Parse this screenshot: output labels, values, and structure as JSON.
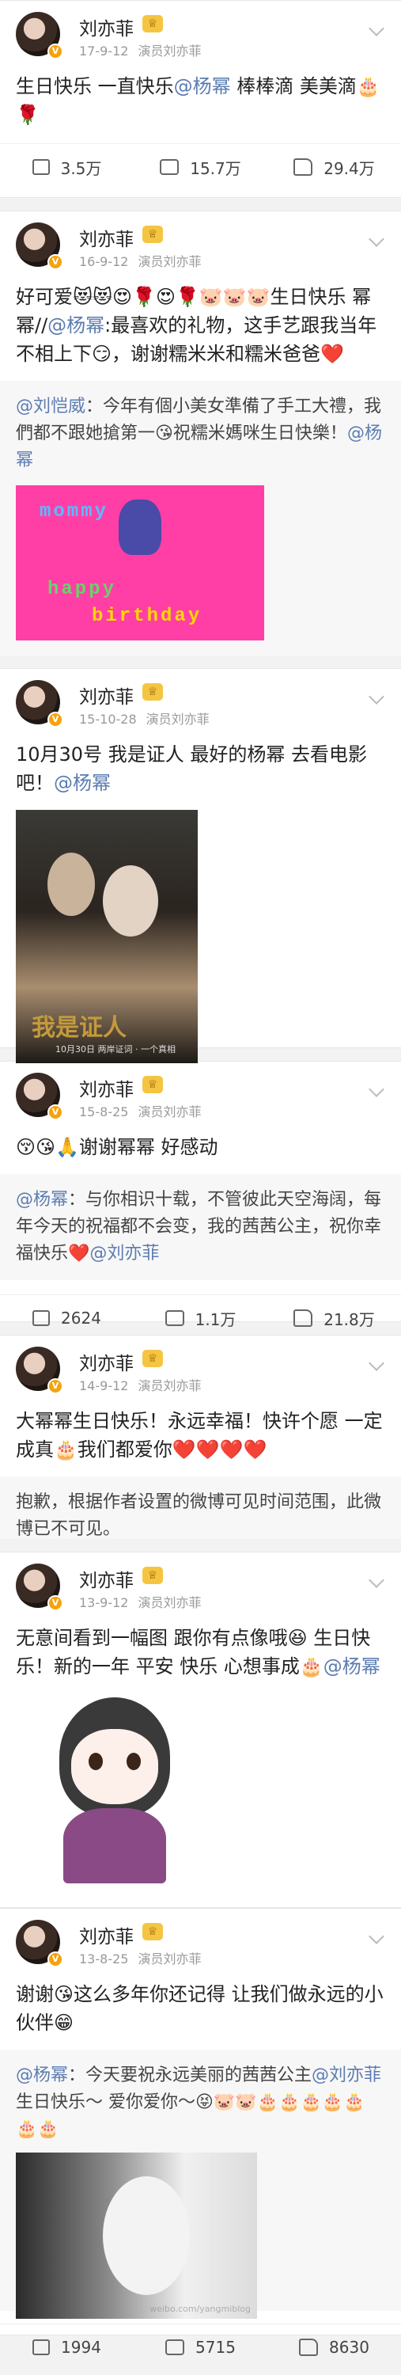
{
  "user": {
    "name": "刘亦菲",
    "verified": "V",
    "crown": "♕",
    "source": "演员刘亦菲"
  },
  "posts": [
    {
      "date": "17-9-12",
      "text_parts": [
        "生日快乐 一直快乐",
        "@杨幂",
        " 棒棒滴 美美滴🎂🌹"
      ],
      "stats": {
        "share": "3.5万",
        "comment": "15.7万",
        "like": "29.4万"
      }
    },
    {
      "date": "16-9-12",
      "text_parts": [
        "好可爱😻😻😍🌹😍🌹🐷🐷🐷生日快乐 幂幂//",
        "@杨幂",
        ":最喜欢的礼物，这手艺跟我当年不相上下😏，谢谢糯米米和糯米爸爸❤️"
      ],
      "repost_parts": [
        "@刘恺威",
        "：今年有個小美女準備了手工大禮，我們都不跟她搶第一😘祝糯米媽咪生日快樂！",
        "@杨幂"
      ],
      "image_words": [
        "mommy",
        "happy",
        "birthday"
      ]
    },
    {
      "date": "15-10-28",
      "text_parts": [
        "10月30号 我是证人 最好的杨幂 去看电影吧！",
        "@杨幂"
      ],
      "image_title": "我是证人",
      "image_sub": "10月30日 两岸证词 · 一个真相"
    },
    {
      "date": "15-8-25",
      "text_parts": [
        "😚😘🙏谢谢幂幂 好感动"
      ],
      "repost_parts": [
        "@杨幂",
        "：与你相识十载，不管彼此天空海阔，每年今天的祝福都不会变，我的茜茜公主，祝你幸福快乐❤️",
        "@刘亦菲"
      ],
      "stats": {
        "share": "2624",
        "comment": "1.1万",
        "like": "21.8万"
      }
    },
    {
      "date": "14-9-12",
      "text_parts": [
        "大幂幂生日快乐！永远幸福！快许个愿 一定成真🎂我们都爱你❤️❤️❤️❤️"
      ],
      "notice": "抱歉，根据作者设置的微博可见时间范围，此微博已不可见。"
    },
    {
      "date": "13-9-12",
      "text_parts": [
        "无意间看到一幅图 跟你有点像哦😆 生日快乐！新的一年 平安 快乐 心想事成🎂",
        "@杨幂"
      ]
    },
    {
      "date": "13-8-25",
      "text_parts": [
        "谢谢😘这么多年你还记得 让我们做永远的小伙伴😁"
      ],
      "repost_parts": [
        "@杨幂",
        "：今天要祝永远美丽的茜茜公主",
        "@刘亦菲",
        " 生日快乐～ 爱你爱你～😝🐷🐷🎂🎂🎂🎂🎂🎂🎂"
      ],
      "watermark": "weibo.com/yangmiblog",
      "stats": {
        "share": "1994",
        "comment": "5715",
        "like": "8630"
      }
    }
  ]
}
